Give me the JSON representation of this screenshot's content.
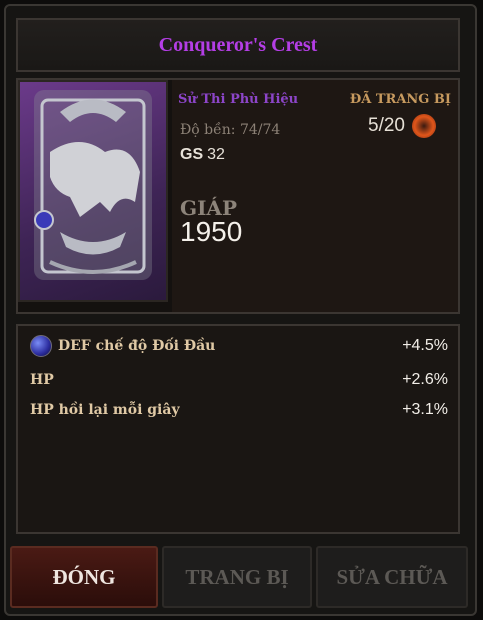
{
  "item": {
    "name": "Conqueror's Crest",
    "type": "Sử Thi Phù Hiệu",
    "equipped_label": "ĐÃ TRANG BỊ",
    "slot": "5/20",
    "durability": "Độ bền: 74/74",
    "gs_label": "GS",
    "gs_value": "32",
    "armor_label": "GIÁP",
    "armor_value": "1950"
  },
  "stats": [
    {
      "name": "DEF chế độ Đối Đầu",
      "value": "+4.5%",
      "has_gem": true
    },
    {
      "name": "HP",
      "value": "+2.6%",
      "has_gem": false
    },
    {
      "name": "HP hồi lại mỗi giây",
      "value": "+3.1%",
      "has_gem": false
    }
  ],
  "buttons": {
    "close": "ĐÓNG",
    "equip": "TRANG BỊ",
    "repair": "SỬA CHỮA"
  },
  "colors": {
    "title": "#b43ee6",
    "rarity": "#8c45c8",
    "equipped": "#c79a5f",
    "close_button": "#4a1a14"
  }
}
